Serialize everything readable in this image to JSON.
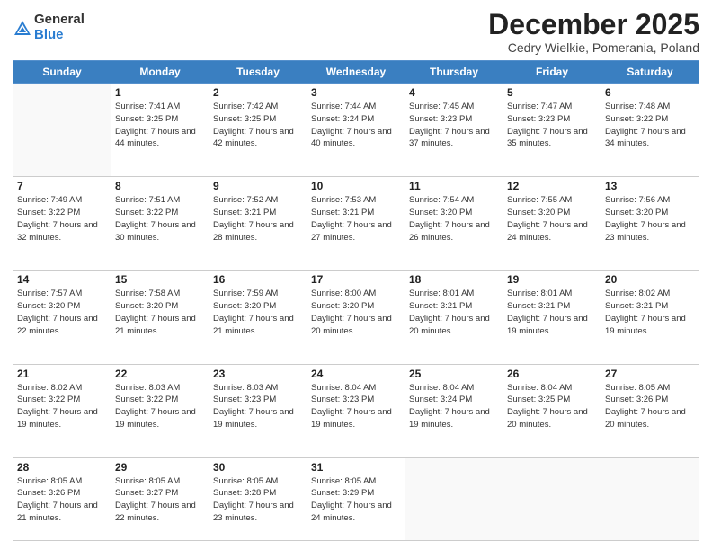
{
  "logo": {
    "general": "General",
    "blue": "Blue"
  },
  "header": {
    "month": "December 2025",
    "location": "Cedry Wielkie, Pomerania, Poland"
  },
  "weekdays": [
    "Sunday",
    "Monday",
    "Tuesday",
    "Wednesday",
    "Thursday",
    "Friday",
    "Saturday"
  ],
  "weeks": [
    [
      {
        "day": "",
        "sunrise": "",
        "sunset": "",
        "daylight": ""
      },
      {
        "day": "1",
        "sunrise": "Sunrise: 7:41 AM",
        "sunset": "Sunset: 3:25 PM",
        "daylight": "Daylight: 7 hours and 44 minutes."
      },
      {
        "day": "2",
        "sunrise": "Sunrise: 7:42 AM",
        "sunset": "Sunset: 3:25 PM",
        "daylight": "Daylight: 7 hours and 42 minutes."
      },
      {
        "day": "3",
        "sunrise": "Sunrise: 7:44 AM",
        "sunset": "Sunset: 3:24 PM",
        "daylight": "Daylight: 7 hours and 40 minutes."
      },
      {
        "day": "4",
        "sunrise": "Sunrise: 7:45 AM",
        "sunset": "Sunset: 3:23 PM",
        "daylight": "Daylight: 7 hours and 37 minutes."
      },
      {
        "day": "5",
        "sunrise": "Sunrise: 7:47 AM",
        "sunset": "Sunset: 3:23 PM",
        "daylight": "Daylight: 7 hours and 35 minutes."
      },
      {
        "day": "6",
        "sunrise": "Sunrise: 7:48 AM",
        "sunset": "Sunset: 3:22 PM",
        "daylight": "Daylight: 7 hours and 34 minutes."
      }
    ],
    [
      {
        "day": "7",
        "sunrise": "Sunrise: 7:49 AM",
        "sunset": "Sunset: 3:22 PM",
        "daylight": "Daylight: 7 hours and 32 minutes."
      },
      {
        "day": "8",
        "sunrise": "Sunrise: 7:51 AM",
        "sunset": "Sunset: 3:22 PM",
        "daylight": "Daylight: 7 hours and 30 minutes."
      },
      {
        "day": "9",
        "sunrise": "Sunrise: 7:52 AM",
        "sunset": "Sunset: 3:21 PM",
        "daylight": "Daylight: 7 hours and 28 minutes."
      },
      {
        "day": "10",
        "sunrise": "Sunrise: 7:53 AM",
        "sunset": "Sunset: 3:21 PM",
        "daylight": "Daylight: 7 hours and 27 minutes."
      },
      {
        "day": "11",
        "sunrise": "Sunrise: 7:54 AM",
        "sunset": "Sunset: 3:20 PM",
        "daylight": "Daylight: 7 hours and 26 minutes."
      },
      {
        "day": "12",
        "sunrise": "Sunrise: 7:55 AM",
        "sunset": "Sunset: 3:20 PM",
        "daylight": "Daylight: 7 hours and 24 minutes."
      },
      {
        "day": "13",
        "sunrise": "Sunrise: 7:56 AM",
        "sunset": "Sunset: 3:20 PM",
        "daylight": "Daylight: 7 hours and 23 minutes."
      }
    ],
    [
      {
        "day": "14",
        "sunrise": "Sunrise: 7:57 AM",
        "sunset": "Sunset: 3:20 PM",
        "daylight": "Daylight: 7 hours and 22 minutes."
      },
      {
        "day": "15",
        "sunrise": "Sunrise: 7:58 AM",
        "sunset": "Sunset: 3:20 PM",
        "daylight": "Daylight: 7 hours and 21 minutes."
      },
      {
        "day": "16",
        "sunrise": "Sunrise: 7:59 AM",
        "sunset": "Sunset: 3:20 PM",
        "daylight": "Daylight: 7 hours and 21 minutes."
      },
      {
        "day": "17",
        "sunrise": "Sunrise: 8:00 AM",
        "sunset": "Sunset: 3:20 PM",
        "daylight": "Daylight: 7 hours and 20 minutes."
      },
      {
        "day": "18",
        "sunrise": "Sunrise: 8:01 AM",
        "sunset": "Sunset: 3:21 PM",
        "daylight": "Daylight: 7 hours and 20 minutes."
      },
      {
        "day": "19",
        "sunrise": "Sunrise: 8:01 AM",
        "sunset": "Sunset: 3:21 PM",
        "daylight": "Daylight: 7 hours and 19 minutes."
      },
      {
        "day": "20",
        "sunrise": "Sunrise: 8:02 AM",
        "sunset": "Sunset: 3:21 PM",
        "daylight": "Daylight: 7 hours and 19 minutes."
      }
    ],
    [
      {
        "day": "21",
        "sunrise": "Sunrise: 8:02 AM",
        "sunset": "Sunset: 3:22 PM",
        "daylight": "Daylight: 7 hours and 19 minutes."
      },
      {
        "day": "22",
        "sunrise": "Sunrise: 8:03 AM",
        "sunset": "Sunset: 3:22 PM",
        "daylight": "Daylight: 7 hours and 19 minutes."
      },
      {
        "day": "23",
        "sunrise": "Sunrise: 8:03 AM",
        "sunset": "Sunset: 3:23 PM",
        "daylight": "Daylight: 7 hours and 19 minutes."
      },
      {
        "day": "24",
        "sunrise": "Sunrise: 8:04 AM",
        "sunset": "Sunset: 3:23 PM",
        "daylight": "Daylight: 7 hours and 19 minutes."
      },
      {
        "day": "25",
        "sunrise": "Sunrise: 8:04 AM",
        "sunset": "Sunset: 3:24 PM",
        "daylight": "Daylight: 7 hours and 19 minutes."
      },
      {
        "day": "26",
        "sunrise": "Sunrise: 8:04 AM",
        "sunset": "Sunset: 3:25 PM",
        "daylight": "Daylight: 7 hours and 20 minutes."
      },
      {
        "day": "27",
        "sunrise": "Sunrise: 8:05 AM",
        "sunset": "Sunset: 3:26 PM",
        "daylight": "Daylight: 7 hours and 20 minutes."
      }
    ],
    [
      {
        "day": "28",
        "sunrise": "Sunrise: 8:05 AM",
        "sunset": "Sunset: 3:26 PM",
        "daylight": "Daylight: 7 hours and 21 minutes."
      },
      {
        "day": "29",
        "sunrise": "Sunrise: 8:05 AM",
        "sunset": "Sunset: 3:27 PM",
        "daylight": "Daylight: 7 hours and 22 minutes."
      },
      {
        "day": "30",
        "sunrise": "Sunrise: 8:05 AM",
        "sunset": "Sunset: 3:28 PM",
        "daylight": "Daylight: 7 hours and 23 minutes."
      },
      {
        "day": "31",
        "sunrise": "Sunrise: 8:05 AM",
        "sunset": "Sunset: 3:29 PM",
        "daylight": "Daylight: 7 hours and 24 minutes."
      },
      {
        "day": "",
        "sunrise": "",
        "sunset": "",
        "daylight": ""
      },
      {
        "day": "",
        "sunrise": "",
        "sunset": "",
        "daylight": ""
      },
      {
        "day": "",
        "sunrise": "",
        "sunset": "",
        "daylight": ""
      }
    ]
  ]
}
